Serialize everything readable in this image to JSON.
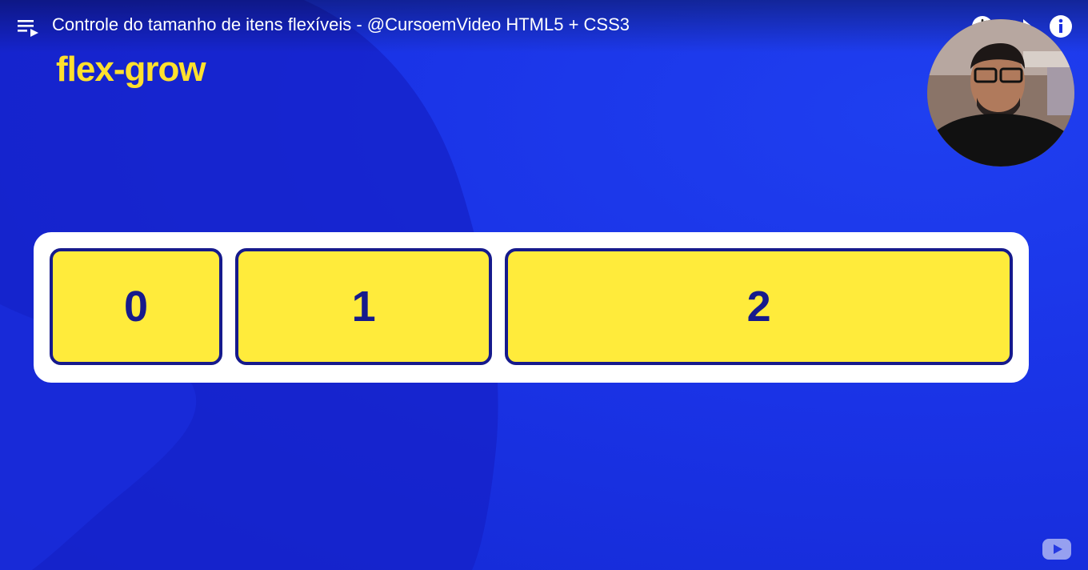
{
  "video": {
    "title": "Controle do tamanho de itens flexíveis - @CursoemVideo HTML5 + CSS3"
  },
  "slide": {
    "heading": "flex-grow",
    "items": [
      "0",
      "1",
      "2"
    ]
  },
  "icons": {
    "playlist": "playlist-icon",
    "watch_later": "clock-icon",
    "share": "share-icon",
    "info": "info-icon",
    "youtube": "youtube-logo-icon"
  },
  "colors": {
    "background": "#1a33e6",
    "heading": "#ffe02e",
    "item_fill": "#ffeb3b",
    "item_border": "#161a8c",
    "container": "#ffffff"
  }
}
